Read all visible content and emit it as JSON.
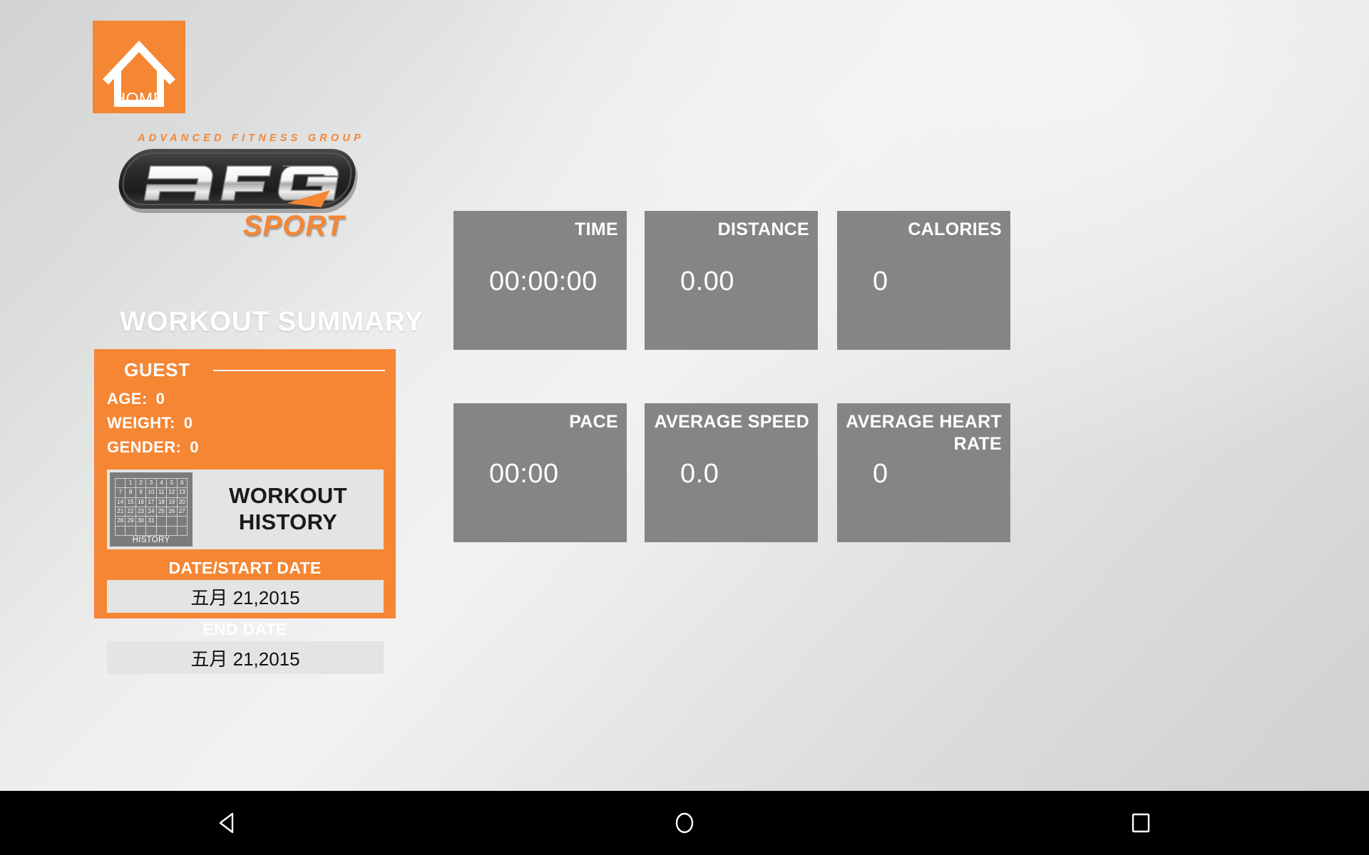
{
  "app": {
    "brand_tagline": "ADVANCED FITNESS GROUP",
    "brand_name": "AFG",
    "brand_sub": "SPORT",
    "accent_color": "#f58634",
    "tile_color": "#858585"
  },
  "home_button": {
    "label": "HOME",
    "icon": "home-icon"
  },
  "page_title": "WORKOUT SUMMARY",
  "guest": {
    "name": "GUEST",
    "fields": [
      {
        "label": "AGE:",
        "value": "0"
      },
      {
        "label": "WEIGHT:",
        "value": "0"
      },
      {
        "label": "GENDER:",
        "value": "0"
      }
    ]
  },
  "history_button": {
    "line1": "WORKOUT",
    "line2": "HISTORY",
    "icon_caption": "HISTORY",
    "calendar_days": [
      "",
      "1",
      "2",
      "3",
      "4",
      "5",
      "6",
      "7",
      "8",
      "9",
      "10",
      "11",
      "12",
      "13",
      "14",
      "15",
      "16",
      "17",
      "18",
      "19",
      "20",
      "21",
      "22",
      "23",
      "24",
      "25",
      "26",
      "27",
      "28",
      "29",
      "30",
      "31",
      "",
      "",
      "",
      "",
      "",
      "",
      "",
      "",
      "",
      ""
    ]
  },
  "dates": {
    "start_label": "DATE/START DATE",
    "start_value": "五月 21,2015",
    "end_label": "END DATE",
    "end_value": "五月 21,2015"
  },
  "metrics": [
    {
      "label": "TIME",
      "value": "00:00:00"
    },
    {
      "label": "DISTANCE",
      "value": "0.00"
    },
    {
      "label": "CALORIES",
      "value": "0"
    },
    {
      "label": "PACE",
      "value": "00:00"
    },
    {
      "label": "AVERAGE SPEED",
      "value": "0.0"
    },
    {
      "label": "AVERAGE HEART RATE",
      "value": "0"
    }
  ],
  "navbar": {
    "back": "back-icon",
    "home": "home-circle-icon",
    "recents": "recents-square-icon"
  }
}
